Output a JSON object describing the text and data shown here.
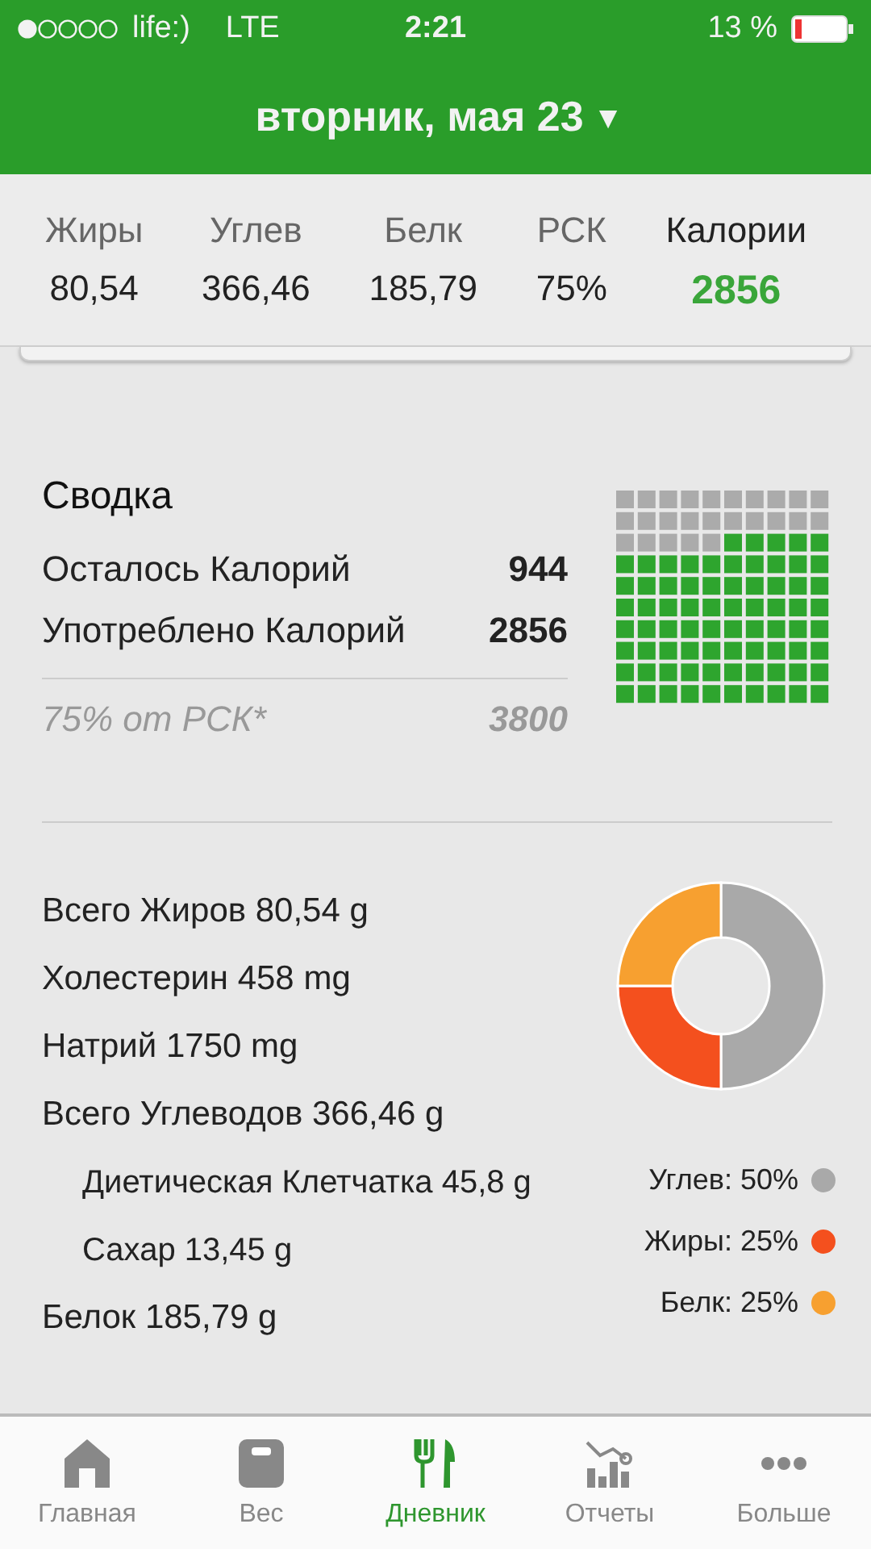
{
  "status_bar": {
    "carrier": "life:)",
    "network": "LTE",
    "time": "2:21",
    "battery": "13 %"
  },
  "header": {
    "date": "вторник, мая 23",
    "caret": "▾"
  },
  "macros": [
    {
      "label": "Жиры",
      "value": "80,54",
      "kind": "macro"
    },
    {
      "label": "Углев",
      "value": "366,46",
      "kind": "macro"
    },
    {
      "label": "Белк",
      "value": "185,79",
      "kind": "macro"
    },
    {
      "label": "РСК",
      "value": "75%",
      "kind": "macro"
    },
    {
      "label": "Калории",
      "value": "2856",
      "kind": "total"
    }
  ],
  "summary": {
    "title": "Сводка",
    "rows": [
      {
        "label": "Осталось Калорий",
        "value": "944"
      },
      {
        "label": "Употреблено Калорий",
        "value": "2856"
      }
    ],
    "footnote": {
      "label": "75% от РСК*",
      "value": "3800"
    }
  },
  "nutrients": [
    {
      "text": "Всего Жиров 80,54 g"
    },
    {
      "text": "Холестерин 458 mg"
    },
    {
      "text": "Натрий 1750 mg"
    },
    {
      "text": "Всего Углеводов 366,46 g",
      "children": [
        {
          "text": "Диетическая Клетчатка 45,8 g"
        },
        {
          "text": "Сахар 13,45 g"
        }
      ]
    },
    {
      "text": "Белок 185,79 g"
    }
  ],
  "macro_chart": {
    "chart_data": {
      "type": "donut",
      "categories": [
        "Углев: 50%",
        "Жиры: 25%",
        "Белк: 25%"
      ],
      "values": [
        50,
        25,
        25
      ]
    },
    "legend": [
      {
        "color": "#a9a9a9"
      },
      {
        "color": "#f4501e"
      },
      {
        "color": "#f7a030"
      }
    ]
  },
  "tabs": [
    {
      "label": "Главная",
      "selected": false
    },
    {
      "label": "Вес",
      "selected": false
    },
    {
      "label": "Дневник",
      "selected": true
    },
    {
      "label": "Отчеты",
      "selected": false
    },
    {
      "label": "Больше",
      "selected": false
    }
  ]
}
